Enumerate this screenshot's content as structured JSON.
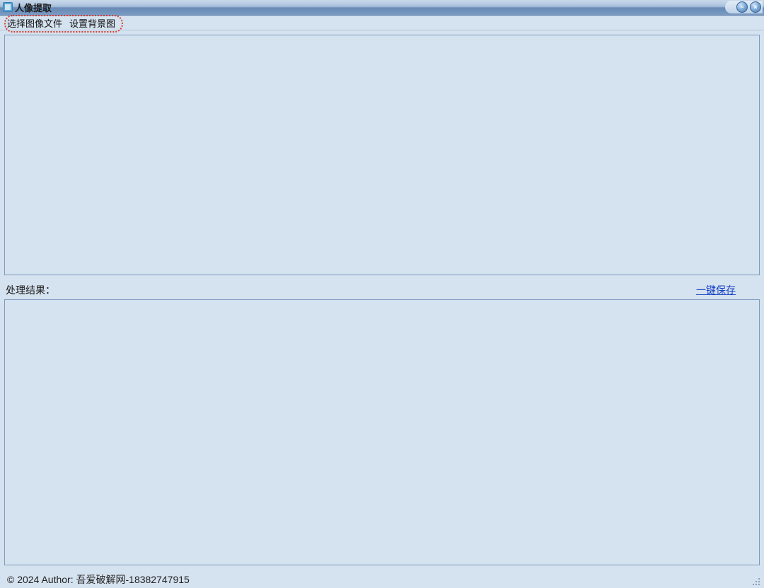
{
  "window": {
    "title": "人像提取"
  },
  "menubar": {
    "select_image_file": "选择图像文件",
    "set_background": "设置背景图"
  },
  "labels": {
    "result_prefix": "处理结果：",
    "save_all": "一键保存"
  },
  "footer": {
    "text": "© 2024 Author: 吾爱破解网-18382747915"
  },
  "icons": {
    "minimize": "−",
    "close": "×"
  }
}
